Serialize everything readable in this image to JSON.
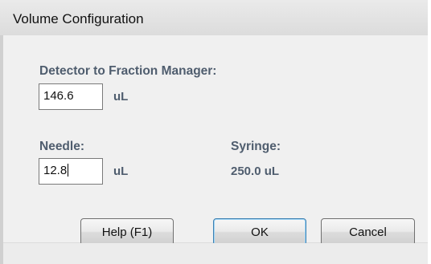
{
  "window": {
    "title": "Volume Configuration"
  },
  "detector_to_fraction_manager": {
    "label": "Detector to Fraction Manager:",
    "value": "146.6",
    "unit": "uL"
  },
  "needle": {
    "label": "Needle:",
    "value": "12.8",
    "unit": "uL"
  },
  "syringe": {
    "label": "Syringe:",
    "value": "250.0 uL"
  },
  "buttons": {
    "help": "Help (F1)",
    "ok": "OK",
    "cancel": "Cancel"
  }
}
